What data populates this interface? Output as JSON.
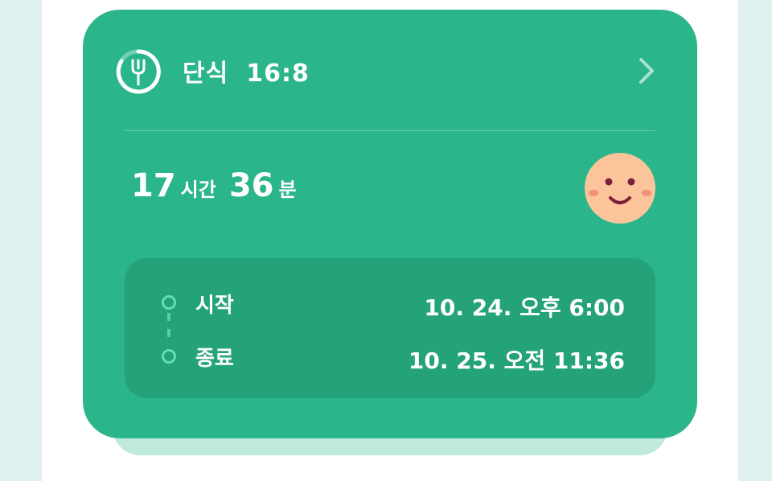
{
  "header": {
    "title": "단식",
    "plan": "16:8",
    "icon": "fork-progress-icon",
    "action_icon": "chevron-right-icon"
  },
  "elapsed": {
    "hours": "17",
    "hours_unit": "시간",
    "minutes": "36",
    "minutes_unit": "분"
  },
  "status_avatar": {
    "icon": "smiley-face-icon",
    "color": "#fbc49a"
  },
  "schedule": {
    "start": {
      "label": "시작",
      "value": "10. 24. 오후 6:00"
    },
    "end": {
      "label": "종료",
      "value": "10. 25. 오전 11:36"
    }
  },
  "colors": {
    "card": "#2bb58a",
    "panel": "#24a27a",
    "accent": "#5fe0b4",
    "background": "#dff1ee"
  }
}
